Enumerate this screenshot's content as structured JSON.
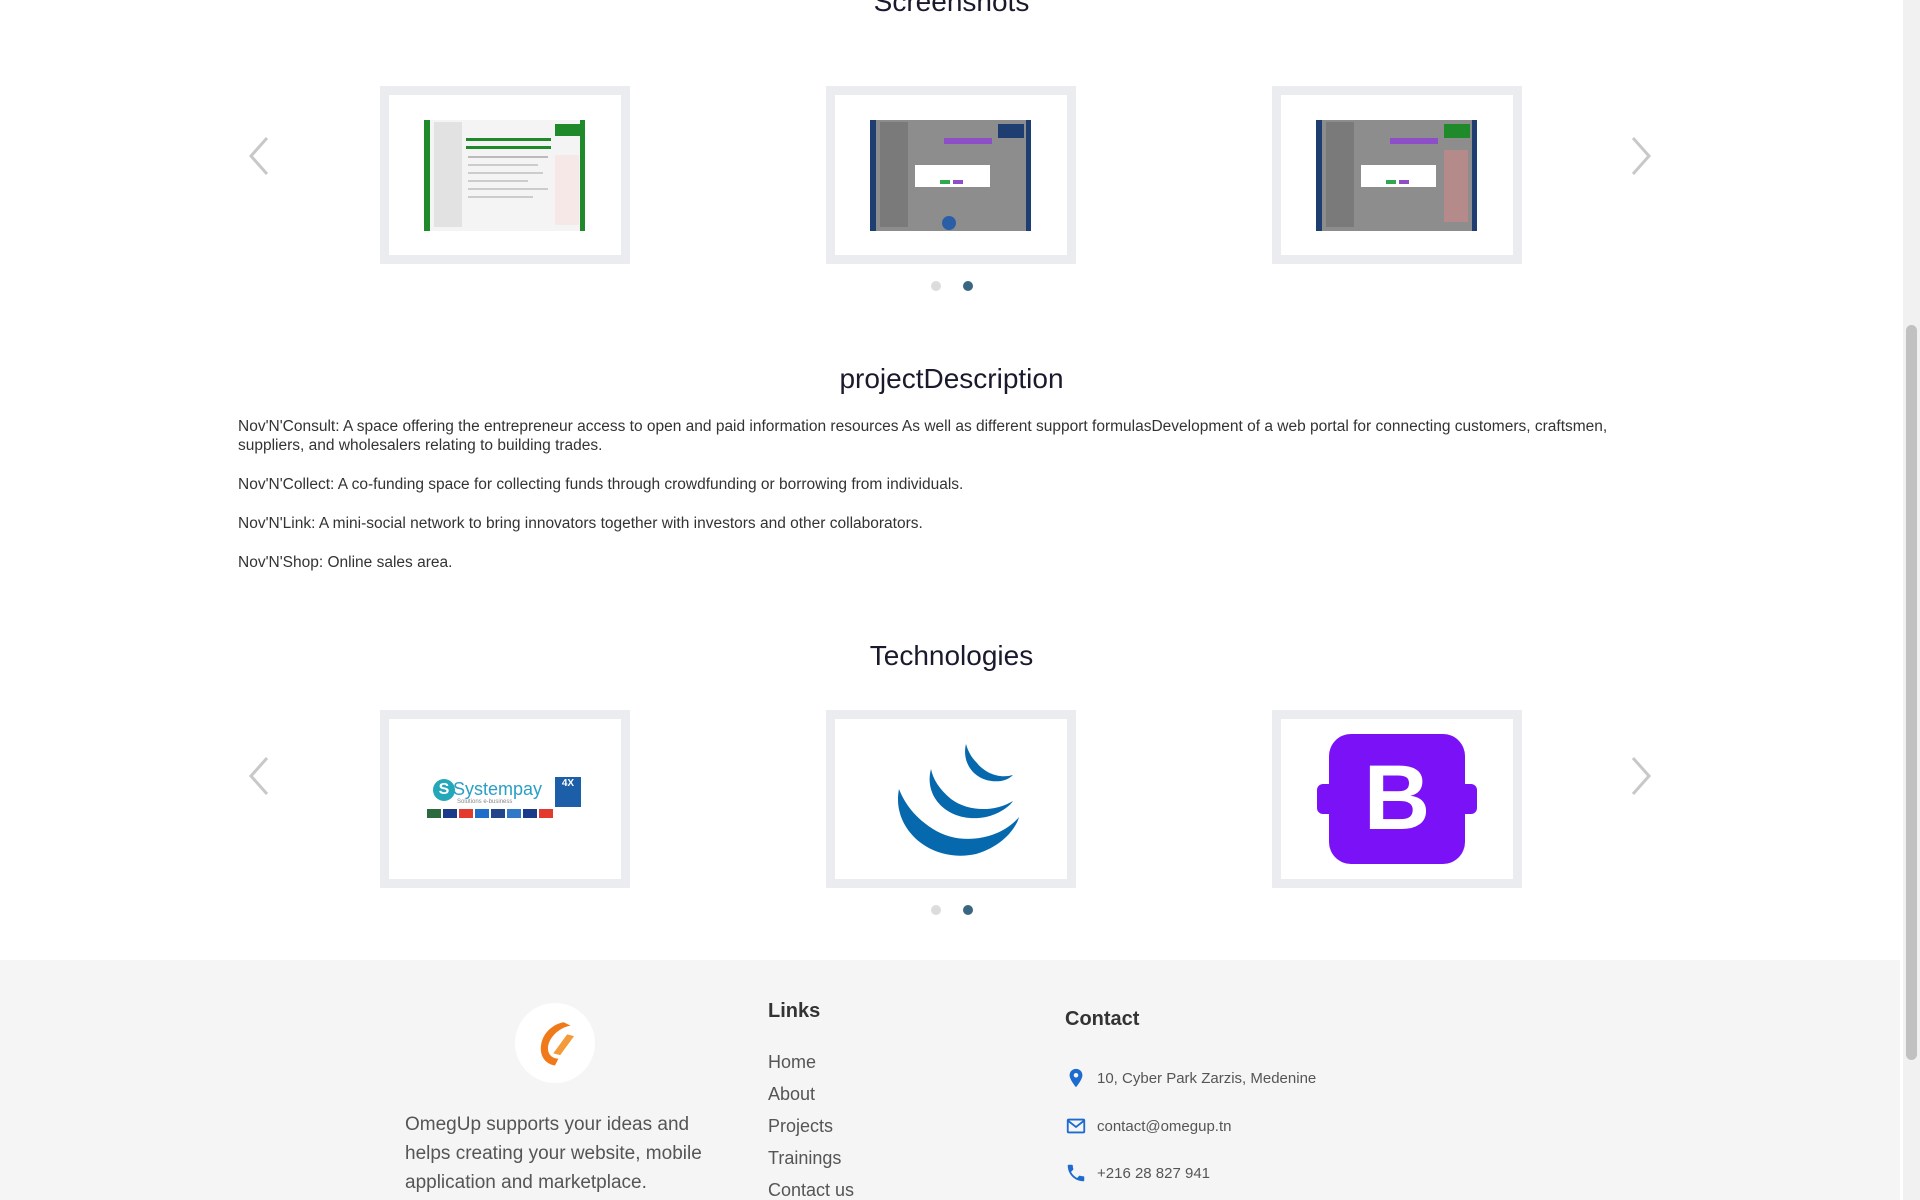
{
  "sections": {
    "screenshots_title": "Screenshots",
    "description_title": "projectDescription",
    "technologies_title": "Technologies"
  },
  "description": [
    "Nov'N'Consult: A space offering the entrepreneur access to open and paid information resources As well as different support formulasDevelopment of a web portal for connecting customers, craftsmen, suppliers, and wholesalers relating to building trades.",
    "Nov'N'Collect: A co-funding space for collecting funds through crowdfunding or borrowing from individuals.",
    "Nov'N'Link: A mini-social network to bring innovators together with investors and other collaborators.",
    "Nov'N'Shop: Online sales area."
  ],
  "carousels": {
    "screenshots": {
      "active_dot": 2,
      "dot_count": 2
    },
    "technologies": {
      "active_dot": 2,
      "dot_count": 2,
      "items": [
        {
          "name": "systempay",
          "text": "Systempay",
          "subtext": "Solutions e-business",
          "badge": "4X"
        },
        {
          "name": "jquery",
          "icon": "jquery-logo"
        },
        {
          "name": "bootstrap",
          "text": "B",
          "color": "#7b11f7"
        }
      ]
    }
  },
  "footer": {
    "about": "OmegUp supports your ideas and helps creating your website, mobile application and marketplace.",
    "links_title": "Links",
    "links": [
      "Home",
      "About",
      "Projects",
      "Trainings",
      "Contact us"
    ],
    "contact_title": "Contact",
    "address": "10, Cyber Park Zarzis, Medenine",
    "email": "contact@omegup.tn",
    "phone": "+216 28 827 941",
    "accent_color": "#1e6bd0"
  }
}
